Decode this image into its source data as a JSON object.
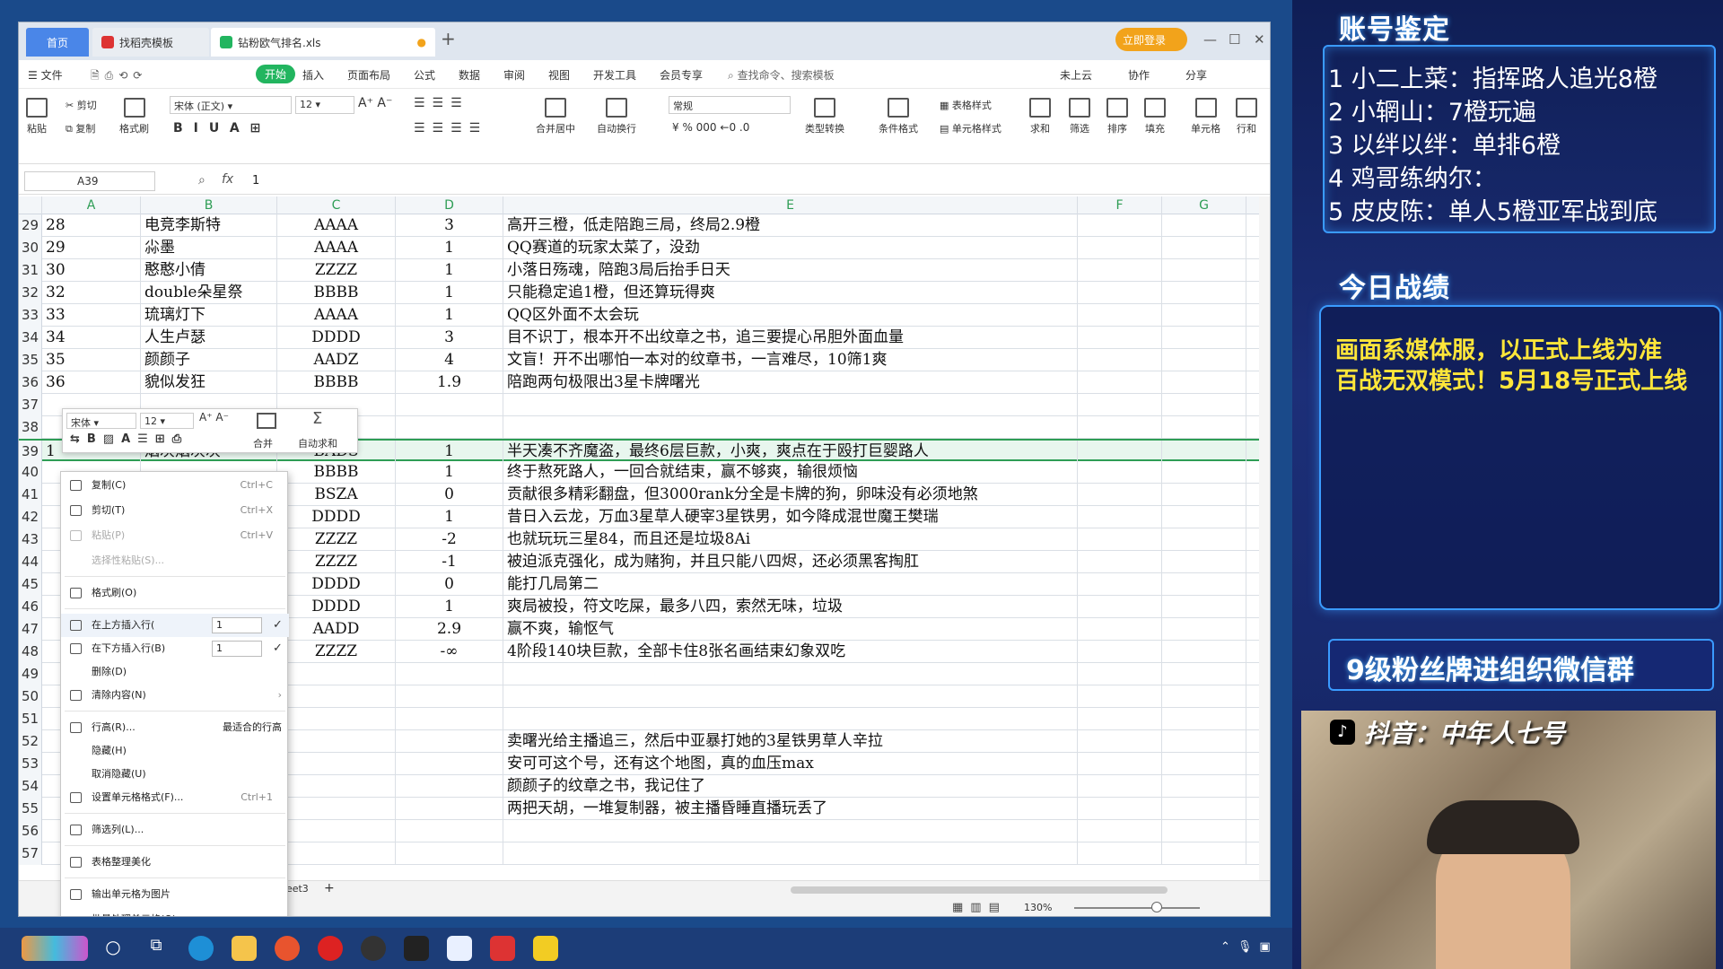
{
  "window": {
    "tabs": [
      {
        "label": "首页"
      },
      {
        "label": "找稻壳模板"
      },
      {
        "label": "钻粉欧气排名.xls"
      }
    ],
    "login_label": "立即登录"
  },
  "menu": {
    "items": [
      "文件",
      "开始",
      "插入",
      "页面布局",
      "公式",
      "数据",
      "审阅",
      "视图",
      "开发工具",
      "会员专享"
    ],
    "search_placeholder": "查找命令、搜索模板",
    "right": [
      "未上云",
      "协作",
      "分享"
    ]
  },
  "ribbon": {
    "paste": "粘贴",
    "cut": "剪切",
    "copy": "复制",
    "format_painter": "格式刷",
    "font_name": "宋体 (正文)",
    "font_size": "12",
    "merge_center": "合并居中",
    "wrap": "自动换行",
    "number_format": "常规",
    "type_convert": "类型转换",
    "cond_format": "条件格式",
    "table_style": "表格样式",
    "cell_style": "单元格样式",
    "sum": "求和",
    "filter": "筛选",
    "sort": "排序",
    "fill": "填充",
    "cell": "单元格",
    "rowcol": "行和"
  },
  "formula": {
    "name_box": "A39",
    "value": "1"
  },
  "columns": [
    "A",
    "B",
    "C",
    "D",
    "E",
    "F",
    "G"
  ],
  "rows": [
    {
      "n": "29",
      "a": "28",
      "b": "电竞李斯特",
      "c": "AAAA",
      "d": "3",
      "e": "高开三橙，低走陪跑三局，终局2.9橙"
    },
    {
      "n": "30",
      "a": "29",
      "b": "尛墨",
      "c": "AAAA",
      "d": "1",
      "e": "QQ赛道的玩家太菜了，没劲"
    },
    {
      "n": "31",
      "a": "30",
      "b": "憨憨小倩",
      "c": "ZZZZ",
      "d": "1",
      "e": "小落日殇魂，陪跑3局后抬手日天"
    },
    {
      "n": "32",
      "a": "32",
      "b": "double朵星祭",
      "c": "BBBB",
      "d": "1",
      "e": "只能稳定追1橙，但还算玩得爽"
    },
    {
      "n": "33",
      "a": "33",
      "b": "琉璃灯下",
      "c": "AAAA",
      "d": "1",
      "e": "QQ区外面不太会玩"
    },
    {
      "n": "34",
      "a": "34",
      "b": "人生卢瑟",
      "c": "DDDD",
      "d": "3",
      "e": "目不识丁，根本开不出纹章之书，追三要提心吊胆外面血量"
    },
    {
      "n": "35",
      "a": "35",
      "b": "颜颜子",
      "c": "AADZ",
      "d": "4",
      "e": "文盲！开不出哪怕一本对的纹章书，一言难尽，10筛1爽"
    },
    {
      "n": "36",
      "a": "36",
      "b": "貌似发狂",
      "c": "BBBB",
      "d": "1.9",
      "e": "陪跑两句极限出3星卡牌曙光"
    },
    {
      "n": "37",
      "a": "",
      "b": "",
      "c": "",
      "d": "",
      "e": ""
    },
    {
      "n": "38",
      "a": "",
      "b": "",
      "c": "",
      "d": "",
      "e": ""
    },
    {
      "n": "39",
      "a": "1",
      "b": "烟灰烟灰灰",
      "c": "BADS",
      "d": "1",
      "e": "半天凑不齐魔盗，最终6层巨款，小爽，爽点在于殴打巨婴路人"
    },
    {
      "n": "40",
      "a": "",
      "b": "",
      "c": "BBBB",
      "d": "1",
      "e": "终于熬死路人，一回合就结束，赢不够爽，输很烦恼"
    },
    {
      "n": "41",
      "a": "",
      "b": "",
      "c": "BSZA",
      "d": "0",
      "e": "贡献很多精彩翻盘，但3000rank分全是卡牌的狗，卵味没有必须地煞"
    },
    {
      "n": "42",
      "a": "",
      "b": "",
      "c": "DDDD",
      "d": "1",
      "e": "昔日入云龙，万血3星草人硬宰3星铁男，如今降成混世魔王樊瑞"
    },
    {
      "n": "43",
      "a": "",
      "b": "",
      "c": "ZZZZ",
      "d": "-2",
      "e": "也就玩玩三星84，而且还是垃圾8Ai"
    },
    {
      "n": "44",
      "a": "",
      "b": "",
      "c": "ZZZZ",
      "d": "-1",
      "e": "被迫派克强化，成为赌狗，并且只能八四烬，还必须黑客掏肛"
    },
    {
      "n": "45",
      "a": "",
      "b": "",
      "c": "DDDD",
      "d": "0",
      "e": "能打几局第二"
    },
    {
      "n": "46",
      "a": "",
      "b": "",
      "c": "DDDD",
      "d": "1",
      "e": "爽局被投，符文吃屎，最多八四，索然无味，垃圾"
    },
    {
      "n": "47",
      "a": "",
      "b": "",
      "c": "AADD",
      "d": "2.9",
      "e": "赢不爽，输怄气"
    },
    {
      "n": "48",
      "a": "",
      "b": "",
      "c": "ZZZZ",
      "d": "-∞",
      "e": "4阶段140块巨款，全部卡住8张名画结束幻象双吃"
    },
    {
      "n": "49",
      "a": "",
      "b": "",
      "c": "",
      "d": "",
      "e": ""
    },
    {
      "n": "50",
      "a": "",
      "b": "",
      "c": "",
      "d": "",
      "e": ""
    },
    {
      "n": "51",
      "a": "",
      "b": "",
      "c": "",
      "d": "",
      "e": ""
    },
    {
      "n": "52",
      "a": "",
      "b": "",
      "c": "",
      "d": "",
      "e": "卖曙光给主播追三，然后中亚暴打她的3星铁男草人辛拉"
    },
    {
      "n": "53",
      "a": "",
      "b": "",
      "c": "",
      "d": "",
      "e": "安可可这个号，还有这个地图，真的血压max"
    },
    {
      "n": "54",
      "a": "",
      "b": "",
      "c": "",
      "d": "",
      "e": "颜颜子的纹章之书，我记住了"
    },
    {
      "n": "55",
      "a": "",
      "b": "",
      "c": "",
      "d": "",
      "e": "两把天胡，一堆复制器，被主播昏睡直播玩丢了"
    },
    {
      "n": "56",
      "a": "",
      "b": "",
      "c": "",
      "d": "",
      "e": ""
    },
    {
      "n": "57",
      "a": "",
      "b": "",
      "c": "",
      "d": "",
      "e": ""
    }
  ],
  "mini_toolbar": {
    "font": "宋体",
    "size": "12",
    "merge": "合并",
    "autosum": "自动求和"
  },
  "context_menu": {
    "copy": "复制(C)",
    "copy_sc": "Ctrl+C",
    "cut": "剪切(T)",
    "cut_sc": "Ctrl+X",
    "paste": "粘贴(P)",
    "paste_sc": "Ctrl+V",
    "paste_special": "选择性粘贴(S)...",
    "format_painter": "格式刷(O)",
    "insert_above": "在上方插入行(",
    "insert_above_val": "1",
    "insert_below": "在下方插入行(B)",
    "insert_below_val": "1",
    "delete": "删除(D)",
    "clear": "清除内容(N)",
    "row_height": "行高(R)...",
    "best_fit": "最适合的行高",
    "hide": "隐藏(H)",
    "unhide": "取消隐藏(U)",
    "format_cells": "设置单元格格式(F)...",
    "format_cells_sc": "Ctrl+1",
    "filter_col": "筛选列(L)...",
    "beautify": "表格整理美化",
    "export_img": "输出单元格为图片",
    "batch": "批量处理单元格(Q)"
  },
  "sheet": {
    "tab": "Sheet3"
  },
  "status": {
    "zoom": "130%"
  },
  "stream": {
    "title1": "账号鉴定",
    "accounts": [
      "1 小二上菜：指挥路人追光8橙",
      "2 小辋山：7橙玩遍",
      "3 以绊以绊：单排6橙",
      "4 鸡哥练纳尔：",
      "5 皮皮陈：单人5橙亚军战到底"
    ],
    "title2": "今日战绩",
    "notices": [
      "画面系媒体服，以正式上线为准",
      "百战无双模式！5月18号正式上线"
    ],
    "fan_group": "9级粉丝牌进组织微信群",
    "douyin": "抖音：中年人七号"
  }
}
